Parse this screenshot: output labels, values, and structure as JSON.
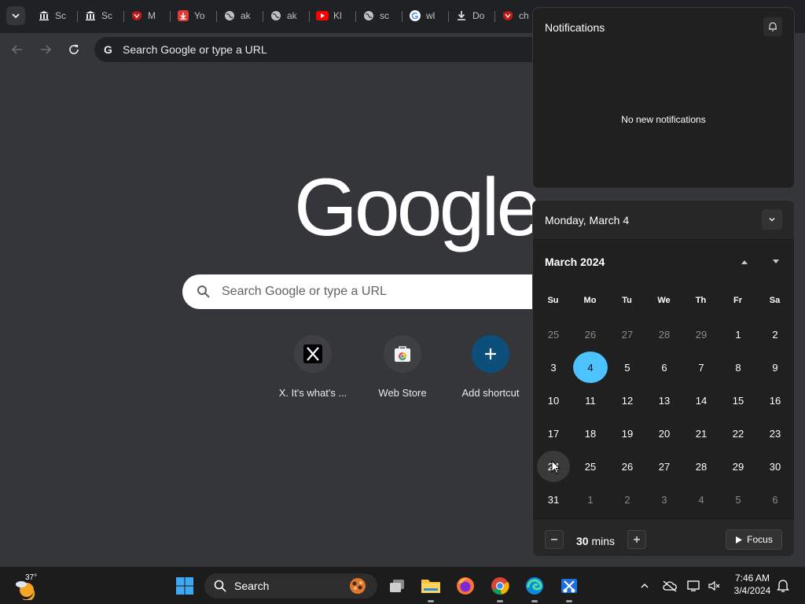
{
  "browser": {
    "tabs": [
      {
        "icon": "bank-icon",
        "title": "Sc"
      },
      {
        "icon": "bank-icon",
        "title": "Sc"
      },
      {
        "icon": "mcafee-icon",
        "title": "M"
      },
      {
        "icon": "download-red-icon",
        "title": "Yo"
      },
      {
        "icon": "globe-icon",
        "title": "ak"
      },
      {
        "icon": "globe-icon",
        "title": "ak"
      },
      {
        "icon": "youtube-icon",
        "title": "Kl"
      },
      {
        "icon": "globe-icon",
        "title": "sc"
      },
      {
        "icon": "google-icon",
        "title": "wl"
      },
      {
        "icon": "download-icon",
        "title": "Do"
      },
      {
        "icon": "mcafee-icon",
        "title": "ch"
      }
    ],
    "omnibox_placeholder": "Search Google or type a URL"
  },
  "ntp": {
    "logo": "Google",
    "search_placeholder": "Search Google or type a URL",
    "shortcuts": [
      {
        "label": "X. It's what's ...",
        "icon": "x-logo-icon"
      },
      {
        "label": "Web Store",
        "icon": "web-store-icon"
      },
      {
        "label": "Add shortcut",
        "icon": "plus-icon"
      }
    ]
  },
  "notifications": {
    "title": "Notifications",
    "empty_text": "No new notifications"
  },
  "calendar": {
    "header_date": "Monday, March 4",
    "month_label": "March 2024",
    "weekdays": [
      "Su",
      "Mo",
      "Tu",
      "We",
      "Th",
      "Fr",
      "Sa"
    ],
    "weeks": [
      [
        {
          "d": "25",
          "o": true
        },
        {
          "d": "26",
          "o": true
        },
        {
          "d": "27",
          "o": true
        },
        {
          "d": "28",
          "o": true
        },
        {
          "d": "29",
          "o": true
        },
        {
          "d": "1"
        },
        {
          "d": "2"
        }
      ],
      [
        {
          "d": "3"
        },
        {
          "d": "4",
          "sel": true
        },
        {
          "d": "5"
        },
        {
          "d": "6"
        },
        {
          "d": "7"
        },
        {
          "d": "8"
        },
        {
          "d": "9"
        }
      ],
      [
        {
          "d": "10"
        },
        {
          "d": "11"
        },
        {
          "d": "12"
        },
        {
          "d": "13"
        },
        {
          "d": "14"
        },
        {
          "d": "15"
        },
        {
          "d": "16"
        }
      ],
      [
        {
          "d": "17"
        },
        {
          "d": "18"
        },
        {
          "d": "19"
        },
        {
          "d": "20"
        },
        {
          "d": "21"
        },
        {
          "d": "22"
        },
        {
          "d": "23"
        }
      ],
      [
        {
          "d": "24",
          "hov": true
        },
        {
          "d": "25"
        },
        {
          "d": "26"
        },
        {
          "d": "27"
        },
        {
          "d": "28"
        },
        {
          "d": "29"
        },
        {
          "d": "30"
        }
      ],
      [
        {
          "d": "31"
        },
        {
          "d": "1",
          "o": true
        },
        {
          "d": "2",
          "o": true
        },
        {
          "d": "3",
          "o": true
        },
        {
          "d": "4",
          "o": true
        },
        {
          "d": "5",
          "o": true
        },
        {
          "d": "6",
          "o": true
        }
      ]
    ],
    "focus": {
      "minutes_value": "30",
      "minutes_unit": "mins",
      "focus_label": "Focus"
    },
    "accent": "#4cc2ff"
  },
  "taskbar": {
    "weather_temp": "37°",
    "search_label": "Search",
    "time": "7:46 AM",
    "date": "3/4/2024"
  }
}
